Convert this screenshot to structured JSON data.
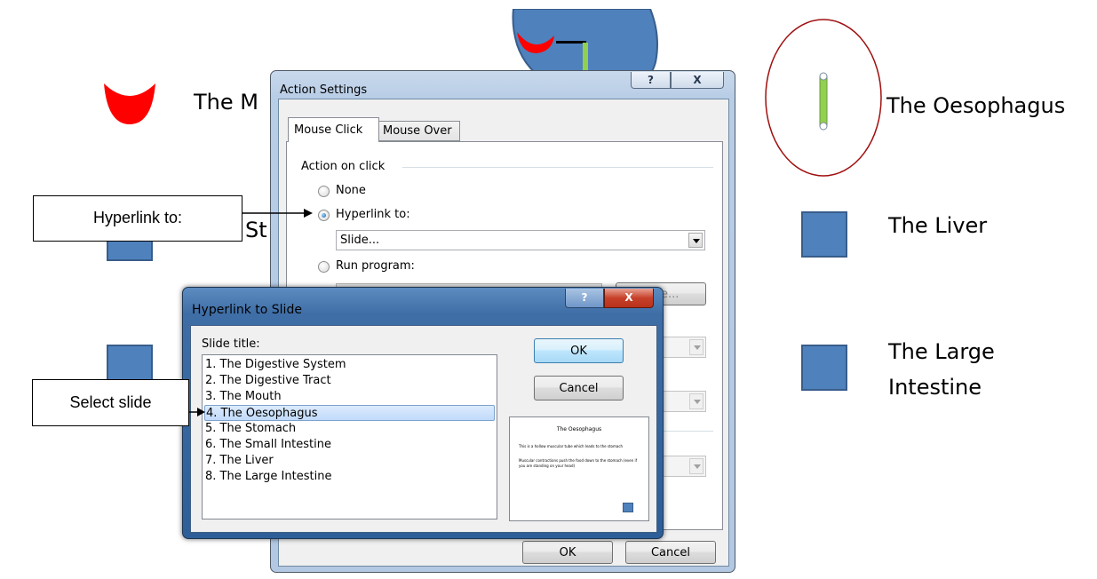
{
  "slide": {
    "items": {
      "mouth": "The M",
      "stomach": "St",
      "oesophagus": "The Oesophagus",
      "liver": "The Liver",
      "large_intestine_line1": "The Large",
      "large_intestine_line2": "Intestine"
    },
    "colors": {
      "mouth_red": "#ff0000",
      "shape_blue": "#4f81bd",
      "oesophagus_green": "#92d050",
      "ellipse_outline": "#a01010"
    }
  },
  "callouts": {
    "hyperlink": "Hyperlink to:",
    "select_slide": "Select slide"
  },
  "action_settings": {
    "title": "Action Settings",
    "help_button": "?",
    "close_button": "X",
    "tabs": [
      "Mouse Click",
      "Mouse Over"
    ],
    "group_label": "Action on click",
    "radio_none": "None",
    "radio_hyperlink": "Hyperlink to:",
    "hyperlink_value": "Slide...",
    "radio_run_program": "Run program:",
    "browse_partial": "e...",
    "ok": "OK",
    "cancel": "Cancel"
  },
  "hyperlink_dialog": {
    "title": "Hyperlink to Slide",
    "help_button": "?",
    "close_button": "X",
    "list_label": "Slide title:",
    "slides": [
      "1. The Digestive System",
      "2. The Digestive Tract",
      "3. The Mouth",
      "4. The Oesophagus",
      "5. The Stomach",
      "6. The Small Intestine",
      "7. The Liver",
      "8. The Large Intestine"
    ],
    "selected_index": 3,
    "ok": "OK",
    "cancel": "Cancel",
    "preview": {
      "title": "The Oesophagus",
      "bullet1": "This is a hollow muscular tube which leads to the stomach",
      "bullet2": "Muscular contractions push the food down to the stomach (even if you are standing on your head)"
    }
  }
}
